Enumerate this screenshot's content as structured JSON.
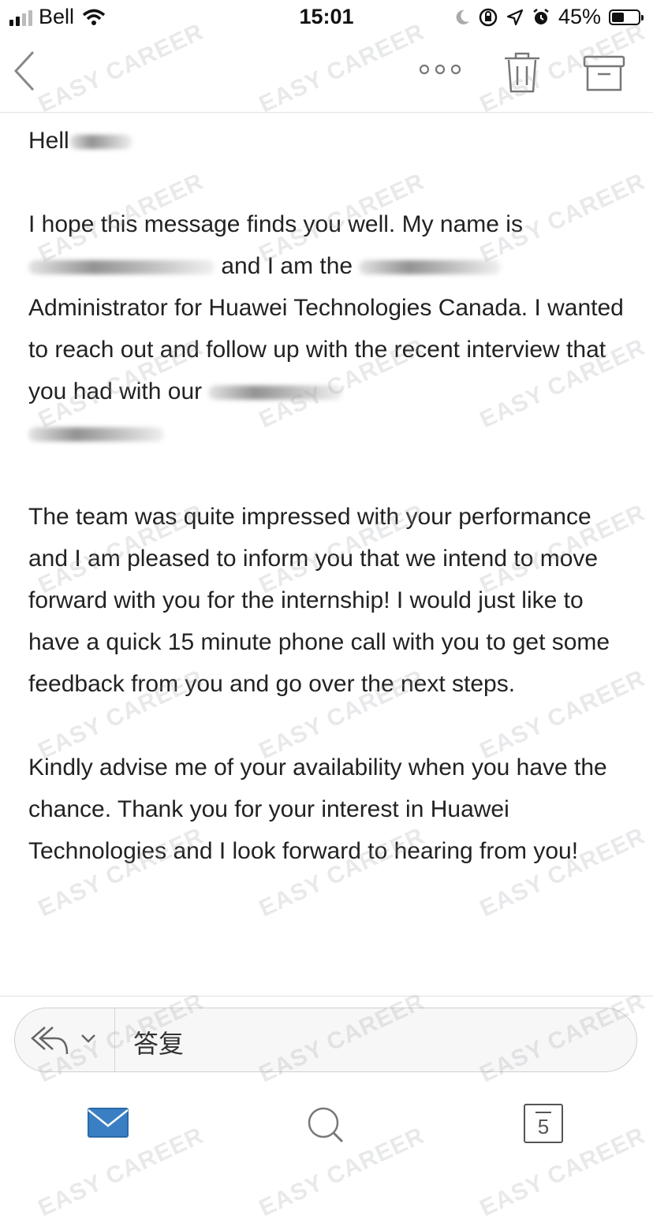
{
  "status_bar": {
    "carrier": "Bell",
    "time": "15:01",
    "battery": "45%",
    "battery_level": 0.45,
    "icons": [
      "signal-icon",
      "wifi-icon",
      "moon-icon",
      "orientation-lock-icon",
      "location-icon",
      "alarm-icon",
      "battery-icon"
    ]
  },
  "nav": {
    "icons": [
      "back-chevron-icon",
      "more-dots-icon",
      "trash-icon",
      "archive-icon"
    ]
  },
  "email": {
    "greeting": "Hell",
    "p1_a": "I hope this message finds you well. My name is",
    "p1_b": "and I am the",
    "p1_c": "Administrator for Huawei Technologies Canada. I wanted to reach out and follow up with the recent interview that you had with our",
    "p2": "The team was quite impressed with your performance and I am pleased to inform you that we intend to move forward with you for the internship! I would just like to have a quick 15 minute phone call with you to get some feedback from you and go over the next steps.",
    "p3": "Kindly advise me of your availability when you have the chance. Thank you for your interest in Huawei Technologies and I look forward to hearing from you!"
  },
  "reply_bar": {
    "label": "答复",
    "icons": [
      "reply-arrows-icon",
      "chevron-down-icon"
    ]
  },
  "tab_bar": {
    "calendar_day": "5",
    "icons": [
      "mail-icon",
      "search-icon",
      "calendar-icon"
    ]
  },
  "watermark": {
    "text": "EASY CAREER"
  },
  "colors": {
    "accent": "#3a7fc4",
    "text": "#222222",
    "divider": "#e3e3e3"
  }
}
